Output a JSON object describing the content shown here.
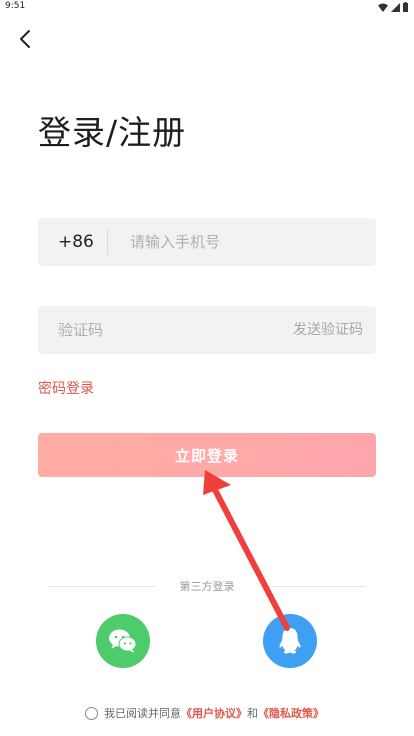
{
  "status_bar": {
    "time": "9:51"
  },
  "header": {
    "title": "登录/注册"
  },
  "phone": {
    "country_code": "+86",
    "placeholder": "请输入手机号"
  },
  "verification": {
    "placeholder": "验证码",
    "send_label": "发送验证码"
  },
  "password_login_label": "密码登录",
  "login_button_label": "立即登录",
  "third_party": {
    "label": "第三方登录",
    "providers": [
      {
        "name": "wechat",
        "icon": "wechat-icon",
        "color": "#4ECB6A"
      },
      {
        "name": "qq",
        "icon": "qq-icon",
        "color": "#3F9FF2"
      }
    ]
  },
  "agreement": {
    "prefix": "我已阅读并同意",
    "user_agreement": "《用户协议》",
    "conjunction": "和",
    "privacy_policy": "《隐私政策》"
  },
  "colors": {
    "accent": "#E0584A",
    "login_gradient_start": "#FFADA3",
    "login_gradient_end": "#FFA6AD",
    "field_bg": "#F2F2F2",
    "annotation_arrow": "#F0403C"
  }
}
